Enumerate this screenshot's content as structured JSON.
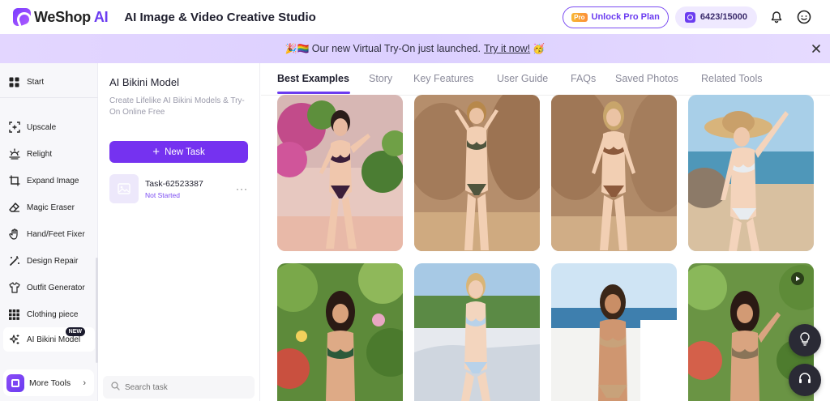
{
  "header": {
    "logo_main": "WeShop",
    "logo_ai": "AI",
    "studio_title": "AI Image & Video Creative Studio",
    "pro_badge": "Pro",
    "unlock_label": "Unlock Pro Plan",
    "credits": "6423/15000"
  },
  "banner": {
    "emoji_left": "🎉🏳️‍🌈",
    "text": "Our new Virtual Try-On just launched.",
    "link": "Try it now!",
    "emoji_right": "🥳"
  },
  "sidebar": {
    "items": [
      {
        "label": "Start",
        "icon": "grid-icon"
      },
      {
        "label": "Upscale",
        "icon": "upscale-icon"
      },
      {
        "label": "Relight",
        "icon": "relight-icon"
      },
      {
        "label": "Expand Image",
        "icon": "expand-icon"
      },
      {
        "label": "Magic Eraser",
        "icon": "eraser-icon"
      },
      {
        "label": "Hand/Feet Fixer",
        "icon": "hand-icon"
      },
      {
        "label": "Design Repair",
        "icon": "magic-wand-icon"
      },
      {
        "label": "Outfit Generator",
        "icon": "shirt-icon"
      },
      {
        "label": "Clothing piece",
        "icon": "clothing-grid-icon"
      },
      {
        "label": "AI Bikini Model",
        "icon": "sparkle-icon",
        "badge": "NEW"
      }
    ],
    "more_tools": "More Tools"
  },
  "task_panel": {
    "title": "AI Bikini Model",
    "description": "Create Lifelike AI Bikini Models & Try-On Online Free",
    "new_task": "New Task",
    "task": {
      "name": "Task-62523387",
      "status": "Not Started"
    },
    "search_placeholder": "Search task"
  },
  "tabs": [
    "Best Examples",
    "Story",
    "Key Features",
    "User Guide",
    "FAQs",
    "Saved Photos",
    "Related Tools"
  ],
  "colors": {
    "accent": "#6b3cf0",
    "button": "#7532f0",
    "banner": "#e0d4ff"
  }
}
